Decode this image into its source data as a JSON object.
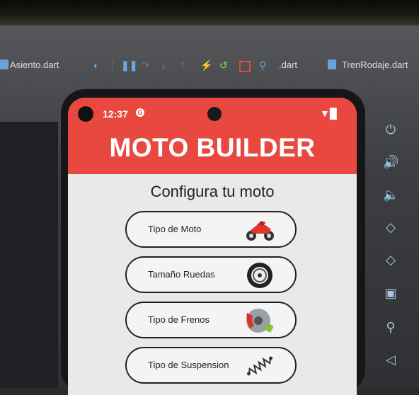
{
  "ide": {
    "tabs": [
      {
        "label": "Asiento.dart"
      },
      {
        "label": ".dart"
      },
      {
        "label": "TrenRodaje.dart"
      }
    ],
    "toolbar_icons": [
      "flutter-icon",
      "devices-icon",
      "pause-icon",
      "reload-icon",
      "step-down-icon",
      "step-up-icon",
      "hot-reload-icon",
      "restart-icon",
      "stop-icon",
      "inspect-icon"
    ]
  },
  "phone": {
    "status": {
      "time": "12:37",
      "notif_glyph": "G"
    },
    "app_title": "MOTO BUILDER",
    "subtitle": "Configura tu moto",
    "options": [
      {
        "label": "Tipo de Moto",
        "icon": "motorcycle-icon"
      },
      {
        "label": "Tamaño Ruedas",
        "icon": "wheel-icon"
      },
      {
        "label": "Tipo de Frenos",
        "icon": "brake-disc-icon"
      },
      {
        "label": "Tipo de Suspension",
        "icon": "spring-icon"
      }
    ]
  },
  "emulator_controls": [
    "power-icon",
    "volume-up-icon",
    "volume-down-icon",
    "rotate-left-icon",
    "rotate-right-icon",
    "camera-icon",
    "zoom-icon",
    "back-icon"
  ],
  "colors": {
    "accent": "#e8483f",
    "screen_bg": "#e9e9e9",
    "text": "#222222"
  }
}
